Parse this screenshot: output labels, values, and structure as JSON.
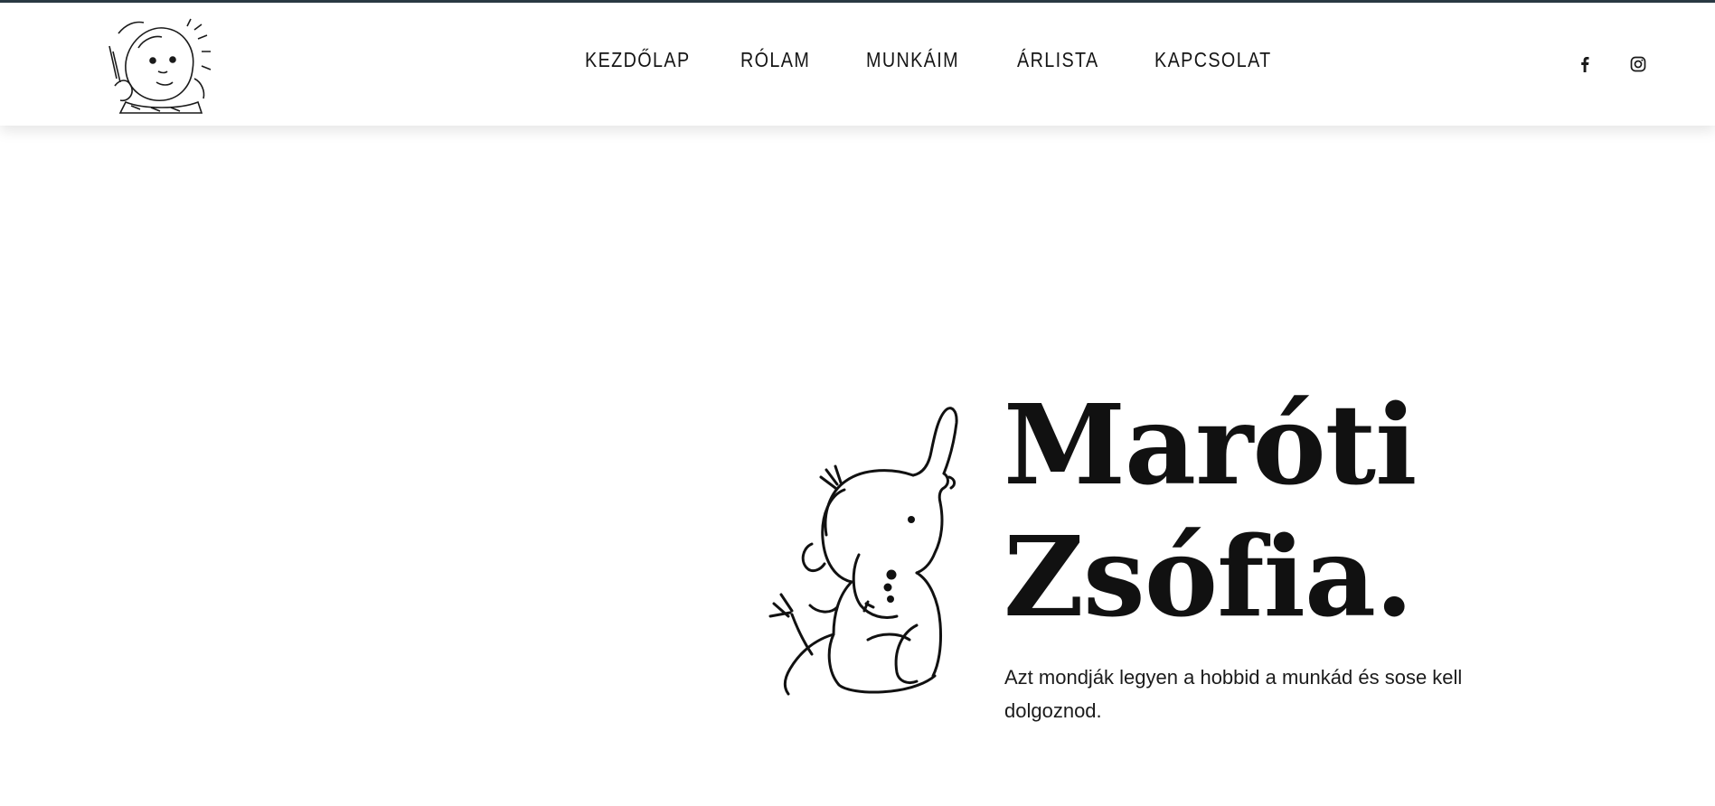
{
  "header": {
    "logo_icon": "baby-illustration-logo",
    "nav": [
      {
        "label": "KEZDŐLAP"
      },
      {
        "label": "RÓLAM"
      },
      {
        "label": "MUNKÁIM"
      },
      {
        "label": "ÁRLISTA"
      },
      {
        "label": "KAPCSOLAT"
      }
    ],
    "social": [
      {
        "icon": "facebook-icon"
      },
      {
        "icon": "instagram-icon"
      }
    ]
  },
  "hero": {
    "illustration_icon": "elephant-illustration",
    "title_line1": "Maróti",
    "title_line2": "Zsófia.",
    "tagline": "Azt mondják legyen a hobbid a munkád és sose kell dolgoznod."
  },
  "colors": {
    "text": "#111111",
    "background": "#ffffff",
    "top_strip": "#2a3a44"
  }
}
